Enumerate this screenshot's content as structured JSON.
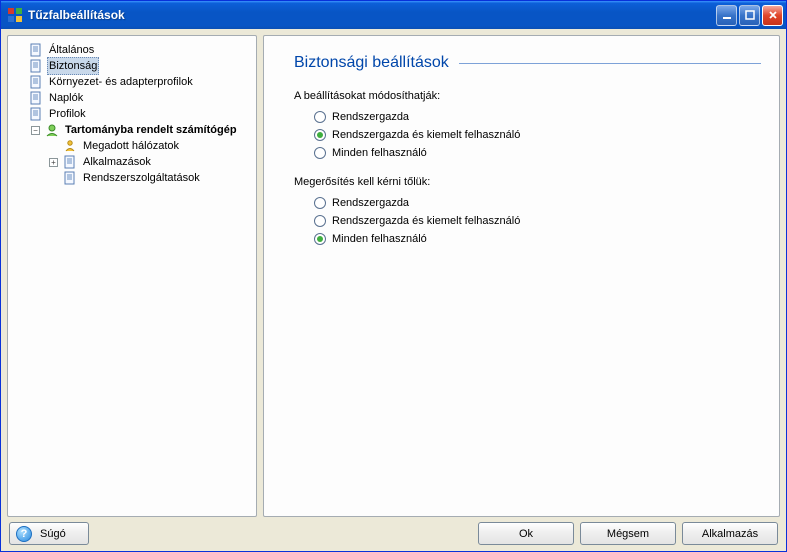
{
  "window": {
    "title": "Tűzfalbeállítások"
  },
  "tree": {
    "general": "Általános",
    "security": "Biztonság",
    "env_adapter": "Környezet- és adapterprofilok",
    "logs": "Naplók",
    "profiles": "Profilok",
    "domain_computer": "Tartományba rendelt számítógép",
    "allowed_networks": "Megadott hálózatok",
    "applications": "Alkalmazások",
    "system_services": "Rendszerszolgáltatások"
  },
  "page": {
    "heading": "Biztonsági beállítások",
    "group_modify": "A beállításokat módosíthatják:",
    "group_confirm": "Megerősítés kell kérni tőlük:",
    "opt_admin": "Rendszergazda",
    "opt_admin_power": "Rendszergazda és kiemelt felhasználó",
    "opt_all": "Minden felhasználó"
  },
  "buttons": {
    "help": "Súgó",
    "ok": "Ok",
    "cancel": "Mégsem",
    "apply": "Alkalmazás"
  },
  "state": {
    "modify_selected": "opt_admin_power",
    "confirm_selected": "opt_all"
  }
}
